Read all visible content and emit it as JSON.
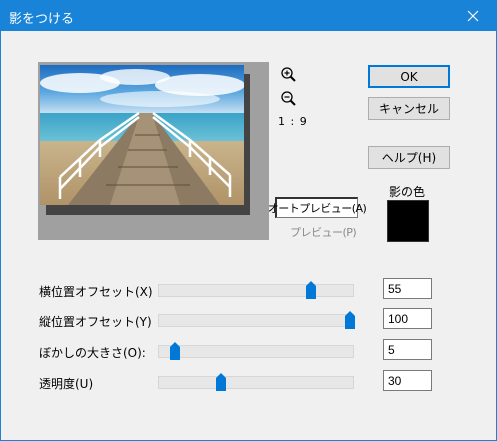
{
  "window": {
    "title": "影をつける",
    "close_icon": "close-icon"
  },
  "preview": {
    "zoom_in_icon": "zoom-in-icon",
    "zoom_out_icon": "zoom-out-icon",
    "zoom_ratio": "1 : 9",
    "auto_preview_label": "オートプレビュー(A)",
    "preview_label": "プレビュー(P)"
  },
  "buttons": {
    "ok": "OK",
    "cancel": "キャンセル",
    "help": "ヘルプ(H)"
  },
  "shadow_color": {
    "label": "影の色",
    "value": "#000000"
  },
  "sliders": [
    {
      "label": "横位置オフセット(X)",
      "value": "55",
      "min": 0,
      "max": 70
    },
    {
      "label": "縦位置オフセット(Y)",
      "value": "100",
      "min": 0,
      "max": 100
    },
    {
      "label": "ぼかしの大きさ(O):",
      "value": "5",
      "min": 0,
      "max": 100
    },
    {
      "label": "透明度(U)",
      "value": "30",
      "min": 0,
      "max": 100
    }
  ],
  "colors": {
    "accent": "#1883d7",
    "thumb": "#0078d7"
  }
}
